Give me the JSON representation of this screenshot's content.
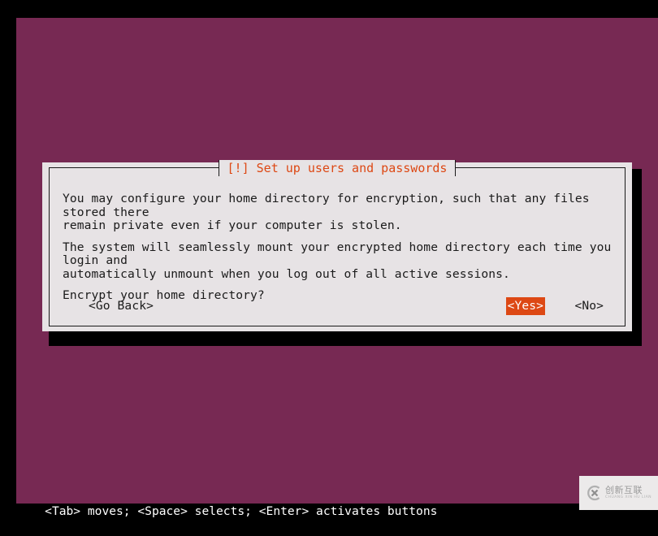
{
  "screen": {
    "background_color": "#772953",
    "outer_color": "#000000"
  },
  "dialog": {
    "title": "[!] Set up users and passwords",
    "title_color": "#dd4814",
    "background_color": "#e7e3e5",
    "paragraphs": [
      "You may configure your home directory for encryption, such that any files stored there\nremain private even if your computer is stolen.",
      "The system will seamlessly mount your encrypted home directory each time you login and\nautomatically unmount when you log out of all active sessions.",
      "Encrypt your home directory?"
    ],
    "buttons": {
      "go_back": "<Go Back>",
      "yes": "<Yes>",
      "no": "<No>",
      "selected": "<Yes>",
      "selected_bg": "#dd4814",
      "selected_fg": "#ffffff"
    }
  },
  "status_bar": {
    "text": "<Tab> moves; <Space> selects; <Enter> activates buttons",
    "color": "#ffffff"
  },
  "watermark": {
    "chinese": "创新互联",
    "pinyin": "CHUANG XIN HU LIAN",
    "icon": "cx-logo-icon",
    "background_color": "#eceaea"
  }
}
